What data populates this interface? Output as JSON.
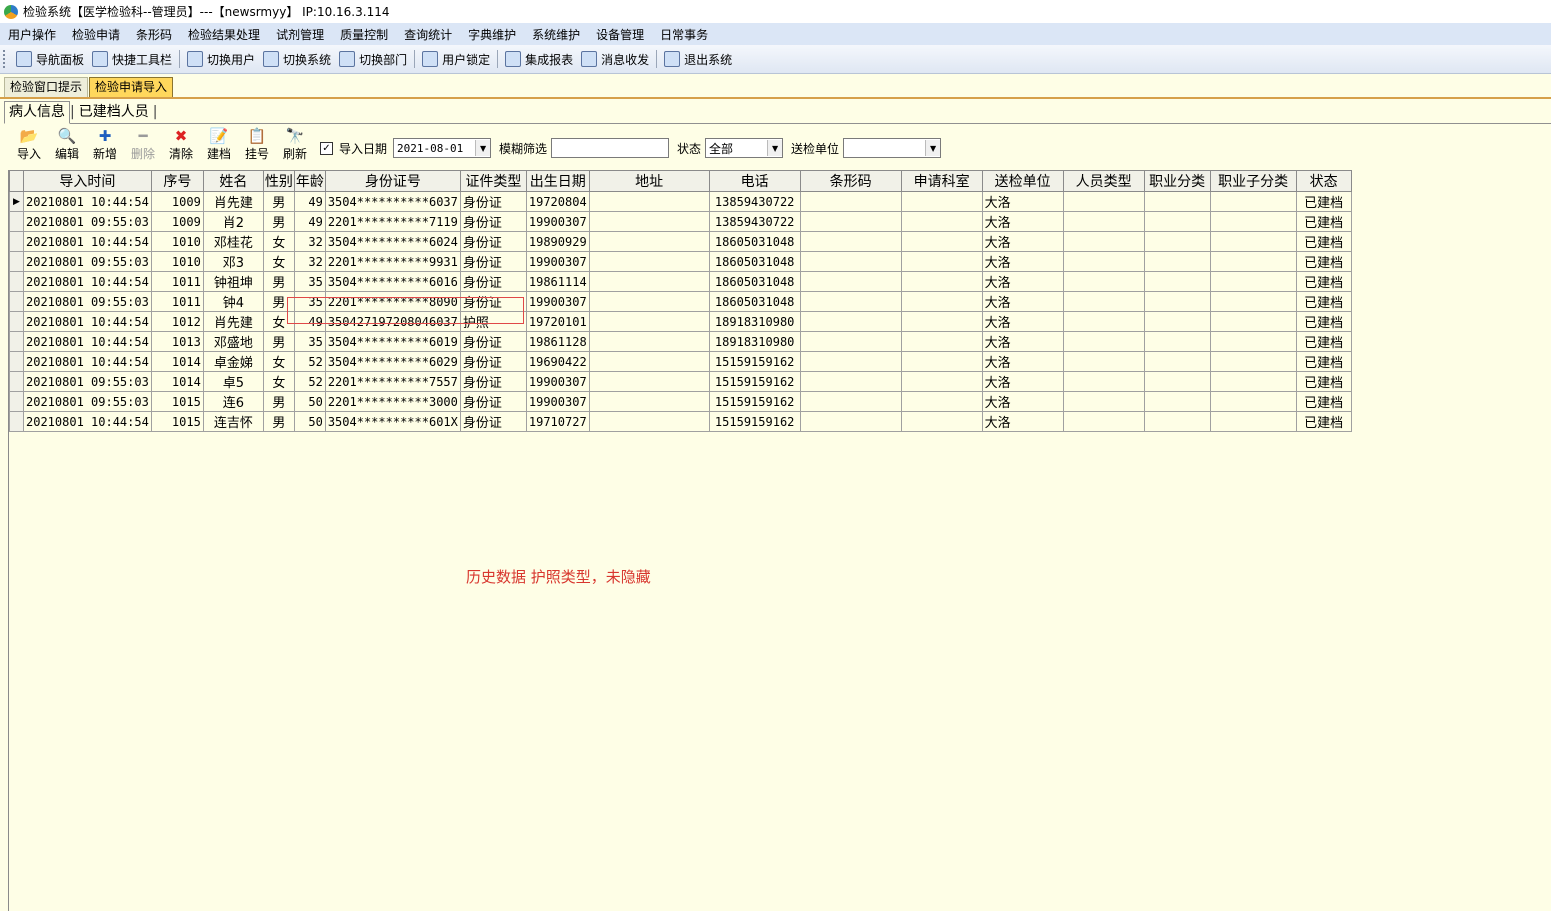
{
  "window": {
    "title": "检验系统【医学检验科--管理员】---【newsrmyy】 IP:10.16.3.114"
  },
  "menu": [
    "用户操作",
    "检验申请",
    "条形码",
    "检验结果处理",
    "试剂管理",
    "质量控制",
    "查询统计",
    "字典维护",
    "系统维护",
    "设备管理",
    "日常事务"
  ],
  "toolbar": {
    "group1": [
      {
        "label": "导航面板",
        "icon": "nav-panel-icon"
      },
      {
        "label": "快捷工具栏",
        "icon": "quick-toolbar-icon"
      }
    ],
    "group2": [
      {
        "label": "切换用户",
        "icon": "switch-user-icon"
      },
      {
        "label": "切换系统",
        "icon": "switch-system-icon"
      },
      {
        "label": "切换部门",
        "icon": "switch-dept-icon"
      }
    ],
    "group3": [
      {
        "label": "用户锁定",
        "icon": "user-lock-icon"
      }
    ],
    "group4": [
      {
        "label": "集成报表",
        "icon": "report-icon"
      },
      {
        "label": "消息收发",
        "icon": "message-icon"
      }
    ],
    "group5": [
      {
        "label": "退出系统",
        "icon": "exit-icon"
      }
    ]
  },
  "tabs": {
    "window_tabs": [
      "检验窗口提示",
      "检验申请导入"
    ],
    "active_window_tab": "检验申请导入",
    "sub_tabs": [
      "病人信息",
      "已建档人员"
    ]
  },
  "actions": [
    {
      "label": "导入",
      "icon": "import-icon",
      "glyph": "📂"
    },
    {
      "label": "编辑",
      "icon": "edit-icon",
      "glyph": "🔍"
    },
    {
      "label": "新增",
      "icon": "add-icon",
      "glyph": "✚"
    },
    {
      "label": "删除",
      "icon": "delete-icon",
      "glyph": "━"
    },
    {
      "label": "清除",
      "icon": "clear-icon",
      "glyph": "✖"
    },
    {
      "label": "建档",
      "icon": "create-record-icon",
      "glyph": "📝"
    },
    {
      "label": "挂号",
      "icon": "register-icon",
      "glyph": "📋"
    },
    {
      "label": "刷新",
      "icon": "refresh-icon",
      "glyph": "🔭"
    }
  ],
  "filters": {
    "import_date_label": "导入日期",
    "import_date_checked": true,
    "import_date_value": "2021-08-01",
    "fuzzy_label": "模糊筛选",
    "fuzzy_value": "",
    "status_label": "状态",
    "status_value": "全部",
    "unit_label": "送检单位",
    "unit_value": ""
  },
  "table": {
    "columns": [
      "导入时间",
      "序号",
      "姓名",
      "性别",
      "年龄",
      "身份证号",
      "证件类型",
      "出生日期",
      "地址",
      "电话",
      "条形码",
      "申请科室",
      "送检单位",
      "人员类型",
      "职业分类",
      "职业子分类",
      "状态"
    ],
    "rows": [
      [
        "20210801 10:44:54",
        "1009",
        "肖先建",
        "男",
        "49",
        "3504**********6037",
        "身份证",
        "19720804",
        "",
        "13859430722",
        "",
        "",
        "大洛",
        "",
        "",
        "",
        "已建档"
      ],
      [
        "20210801 09:55:03",
        "1009",
        "肖2",
        "男",
        "49",
        "2201**********7119",
        "身份证",
        "19900307",
        "",
        "13859430722",
        "",
        "",
        "大洛",
        "",
        "",
        "",
        "已建档"
      ],
      [
        "20210801 10:44:54",
        "1010",
        "邓桂花",
        "女",
        "32",
        "3504**********6024",
        "身份证",
        "19890929",
        "",
        "18605031048",
        "",
        "",
        "大洛",
        "",
        "",
        "",
        "已建档"
      ],
      [
        "20210801 09:55:03",
        "1010",
        "邓3",
        "女",
        "32",
        "2201**********9931",
        "身份证",
        "19900307",
        "",
        "18605031048",
        "",
        "",
        "大洛",
        "",
        "",
        "",
        "已建档"
      ],
      [
        "20210801 10:44:54",
        "1011",
        "钟祖坤",
        "男",
        "35",
        "3504**********6016",
        "身份证",
        "19861114",
        "",
        "18605031048",
        "",
        "",
        "大洛",
        "",
        "",
        "",
        "已建档"
      ],
      [
        "20210801 09:55:03",
        "1011",
        "钟4",
        "男",
        "35",
        "2201**********8090",
        "身份证",
        "19900307",
        "",
        "18605031048",
        "",
        "",
        "大洛",
        "",
        "",
        "",
        "已建档"
      ],
      [
        "20210801 10:44:54",
        "1012",
        "肖先建",
        "女",
        "49",
        "350427197208046037",
        "护照",
        "19720101",
        "",
        "18918310980",
        "",
        "",
        "大洛",
        "",
        "",
        "",
        "已建档"
      ],
      [
        "20210801 10:44:54",
        "1013",
        "邓盛地",
        "男",
        "35",
        "3504**********6019",
        "身份证",
        "19861128",
        "",
        "18918310980",
        "",
        "",
        "大洛",
        "",
        "",
        "",
        "已建档"
      ],
      [
        "20210801 10:44:54",
        "1014",
        "卓金娣",
        "女",
        "52",
        "3504**********6029",
        "身份证",
        "19690422",
        "",
        "15159159162",
        "",
        "",
        "大洛",
        "",
        "",
        "",
        "已建档"
      ],
      [
        "20210801 09:55:03",
        "1014",
        "卓5",
        "女",
        "52",
        "2201**********7557",
        "身份证",
        "19900307",
        "",
        "15159159162",
        "",
        "",
        "大洛",
        "",
        "",
        "",
        "已建档"
      ],
      [
        "20210801 09:55:03",
        "1015",
        "连6",
        "男",
        "50",
        "2201**********3000",
        "身份证",
        "19900307",
        "",
        "15159159162",
        "",
        "",
        "大洛",
        "",
        "",
        "",
        "已建档"
      ],
      [
        "20210801 10:44:54",
        "1015",
        "连吉怀",
        "男",
        "50",
        "3504**********601X",
        "身份证",
        "19710727",
        "",
        "15159159162",
        "",
        "",
        "大洛",
        "",
        "",
        "",
        "已建档"
      ]
    ],
    "selected_row": 0
  },
  "annotation": "历史数据 护照类型，未隐藏"
}
